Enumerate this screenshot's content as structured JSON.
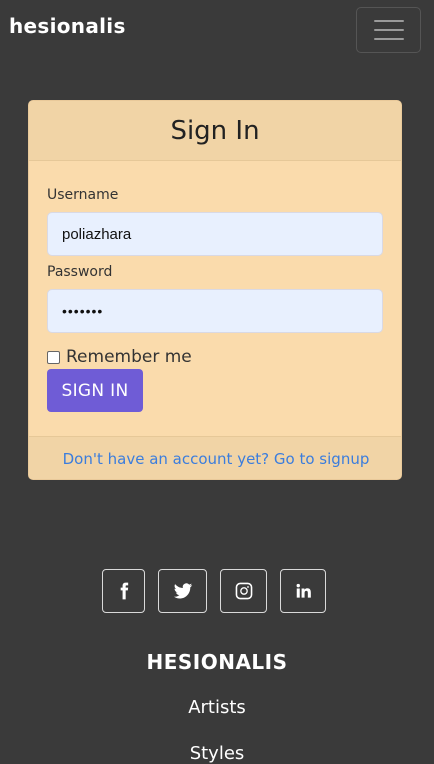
{
  "navbar": {
    "brand": "hesionalis",
    "menu_icon": "hamburger-icon"
  },
  "signin": {
    "title": "Sign In",
    "username_label": "Username",
    "username_value": "poliazhara",
    "password_label": "Password",
    "password_value": "•••••••",
    "remember_label": "Remember me",
    "remember_checked": false,
    "submit_label": "SIGN IN",
    "signup_link": "Don't have an account yet? Go to signup"
  },
  "footer": {
    "social": [
      {
        "icon": "facebook-icon",
        "glyph": "f"
      },
      {
        "icon": "twitter-icon"
      },
      {
        "icon": "instagram-icon"
      },
      {
        "icon": "linkedin-icon",
        "glyph": "in"
      }
    ],
    "brand": "HESIONALIS",
    "links": [
      "Artists",
      "Styles"
    ]
  },
  "colors": {
    "background": "#3a3a3a",
    "card": "#fadbac",
    "card_header": "#f1d4a6",
    "button": "#6f5cd6",
    "link": "#3b7ddd",
    "input": "#e8f0fe"
  }
}
